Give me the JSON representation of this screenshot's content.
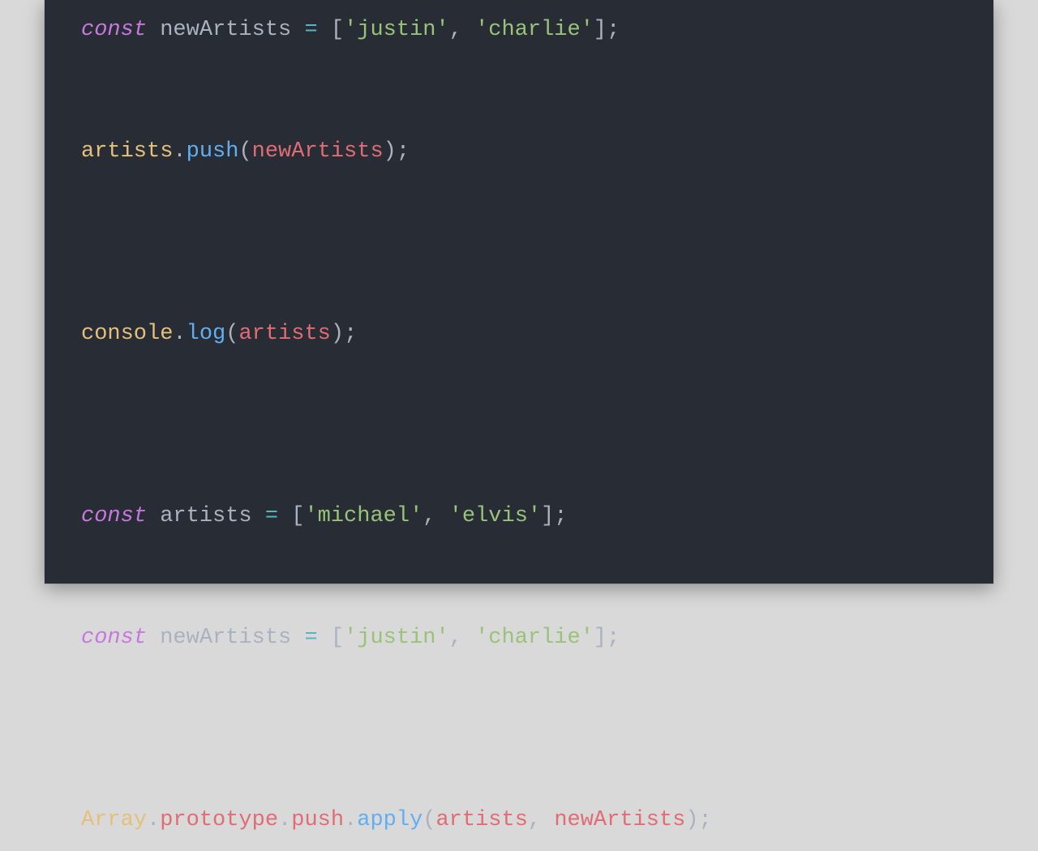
{
  "code": {
    "line1": {
      "kw": "const",
      "name": "newArtists",
      "eq": "=",
      "lbrack": "[",
      "s1": "'justin'",
      "comma": ",",
      "s2": "'charlie'",
      "rbrack": "]",
      "semi": ";"
    },
    "line2": {
      "obj": "artists",
      "dot": ".",
      "fn": "push",
      "lpar": "(",
      "arg": "newArtists",
      "rpar": ")",
      "semi": ";"
    },
    "line3": {
      "obj": "console",
      "dot": ".",
      "fn": "log",
      "lpar": "(",
      "arg": "artists",
      "rpar": ")",
      "semi": ";"
    },
    "line4": {
      "kw": "const",
      "name": "artists",
      "eq": "=",
      "lbrack": "[",
      "s1": "'michael'",
      "comma": ",",
      "s2": "'elvis'",
      "rbrack": "]",
      "semi": ";"
    },
    "line5": {
      "kw": "const",
      "name": "newArtists",
      "eq": "=",
      "lbrack": "[",
      "s1": "'justin'",
      "comma": ",",
      "s2": "'charlie'",
      "rbrack": "]",
      "semi": ";"
    },
    "line6": {
      "arr": "Array",
      "dot1": ".",
      "proto": "prototype",
      "dot2": ".",
      "push": "push",
      "dot3": ".",
      "apply": "apply",
      "lpar": "(",
      "arg1": "artists",
      "comma": ",",
      "arg2": "newArtists",
      "rpar": ")",
      "semi": ";"
    }
  }
}
